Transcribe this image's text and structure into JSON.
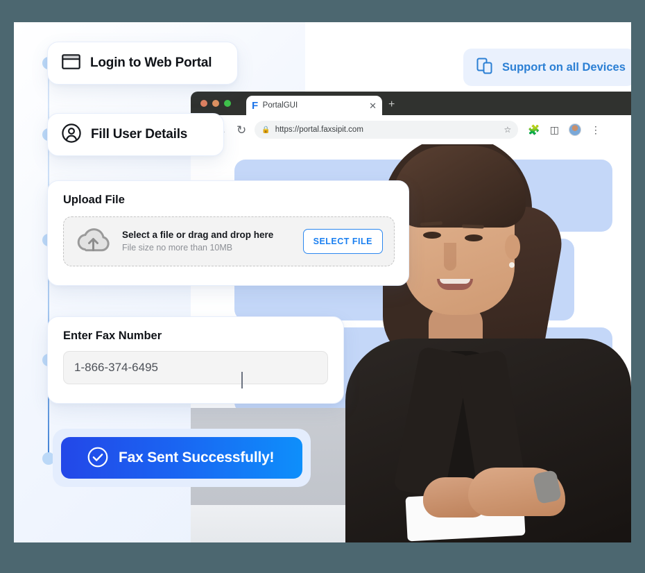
{
  "theme": {
    "page_background": "#4c6770",
    "stage_background": "#ffffff",
    "accent_blue": "#1a7ff0",
    "badge_text_blue": "#2b7fd4",
    "badge_background": "#eaf1fd",
    "timeline_dot": "#bbd8f7",
    "decor_block": "#c4d7f8",
    "success_gradient_from": "#2347e8",
    "success_gradient_to": "#0e8ffb"
  },
  "support_badge": {
    "icon": "devices-icon",
    "label": "Support on all Devices"
  },
  "browser": {
    "traffic_lights": [
      "close-light",
      "minimize-light",
      "maximize-light"
    ],
    "tab": {
      "favicon": "portal-f-favicon",
      "title": "PortalGUI",
      "close_icon": "close-icon"
    },
    "new_tab_icon": "plus-icon",
    "nav": {
      "back_icon": "arrow-left-icon",
      "forward_icon": "arrow-right-icon",
      "reload_icon": "reload-icon"
    },
    "omnibox": {
      "lock_icon": "lock-icon",
      "url": "https://portal.faxsipit.com",
      "bookmark_icon": "star-icon"
    },
    "actions": {
      "extensions_icon": "puzzle-icon",
      "sidepanel_icon": "split-panel-icon",
      "profile_icon": "avatar-icon",
      "menu_icon": "kebab-menu-icon"
    }
  },
  "timeline": {
    "dots": [
      "step-1",
      "step-2",
      "step-3",
      "step-4",
      "step-5"
    ]
  },
  "steps": {
    "login": {
      "icon": "browser-window-icon",
      "label": "Login to Web Portal"
    },
    "details": {
      "icon": "user-circle-icon",
      "label": "Fill User Details"
    },
    "upload": {
      "title": "Upload File",
      "dropzone": {
        "icon": "cloud-upload-icon",
        "primary": "Select a file or drag and drop here",
        "secondary": "File size no more than 10MB"
      },
      "select_button": "SELECT FILE"
    },
    "fax": {
      "title": "Enter Fax Number",
      "input_value": "1-866-374-6495",
      "input_placeholder": "1-866-374-6495"
    },
    "success": {
      "icon": "check-circle-icon",
      "label": "Fax Sent Successfully!"
    }
  }
}
